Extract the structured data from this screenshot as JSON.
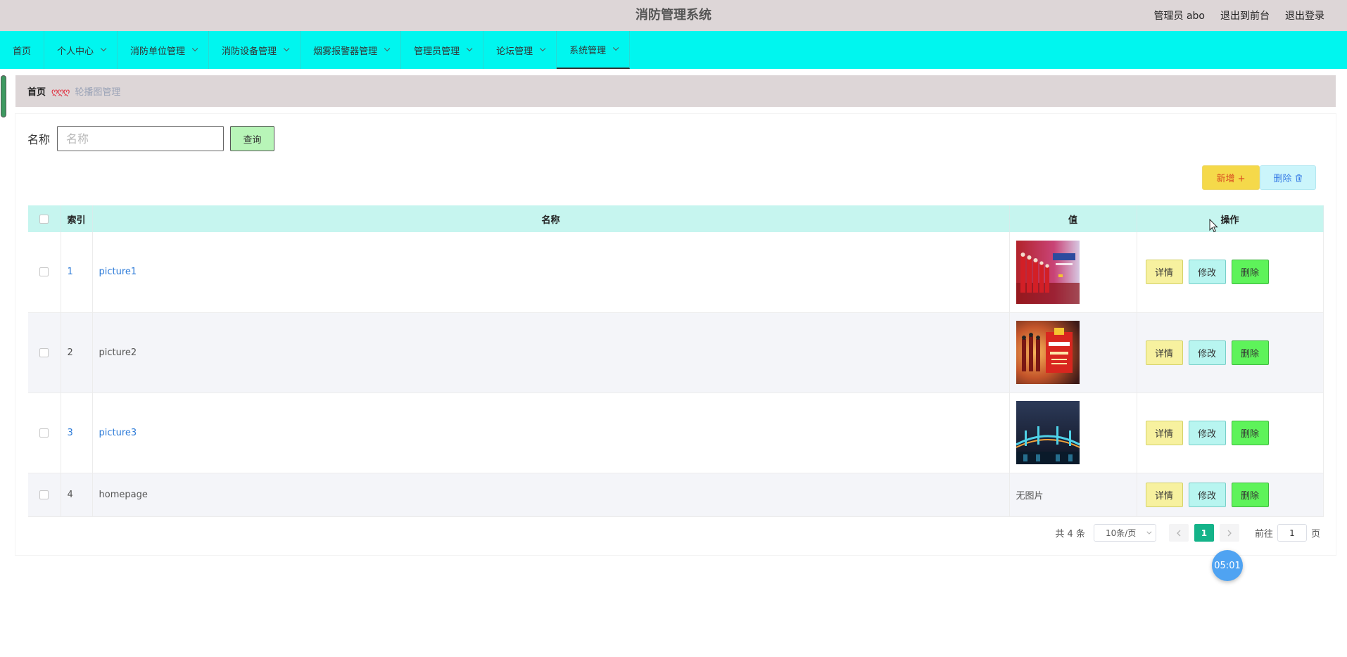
{
  "header": {
    "title": "消防管理系统",
    "user_label": "管理员 abo",
    "front_link": "退出到前台",
    "logout_link": "退出登录"
  },
  "nav": {
    "items": [
      {
        "label": "首页"
      },
      {
        "label": "个人中心"
      },
      {
        "label": "消防单位管理"
      },
      {
        "label": "消防设备管理"
      },
      {
        "label": "烟雾报警器管理"
      },
      {
        "label": "管理员管理"
      },
      {
        "label": "论坛管理"
      },
      {
        "label": "系统管理"
      }
    ],
    "active": "系统管理"
  },
  "breadcrumb": {
    "home": "首页",
    "separator": "ღღღ",
    "current": "轮播图管理"
  },
  "search": {
    "label": "名称",
    "placeholder": "名称",
    "value": "",
    "button": "查询"
  },
  "actions": {
    "add": "新增 +",
    "delete": "删除",
    "add_color": "#f5d94a",
    "delete_color": "#cbf5fb"
  },
  "table": {
    "columns": {
      "index": "索引",
      "name": "名称",
      "value": "值",
      "op": "操作"
    },
    "op_labels": {
      "detail": "详情",
      "edit": "修改",
      "remove": "删除"
    },
    "rows": [
      {
        "index": "1",
        "name": "picture1",
        "value_image": "firefighters-poster"
      },
      {
        "index": "2",
        "name": "picture2",
        "value_image": "fire-safety-poster"
      },
      {
        "index": "3",
        "name": "picture3",
        "value_image": "bridge-night"
      },
      {
        "index": "4",
        "name": "homepage",
        "value_text": "无图片"
      }
    ]
  },
  "pagination": {
    "total": "共 4 条",
    "page_size": "10条/页",
    "current_page": "1",
    "goto_label": "前往",
    "goto_value": "1",
    "page_unit": "页"
  },
  "timer": "05:01",
  "colors": {
    "header_bg": "#ddd6d7",
    "nav_bg": "#00f6ef",
    "table_header_bg": "#c6f5ef",
    "page_active": "#14b389"
  }
}
